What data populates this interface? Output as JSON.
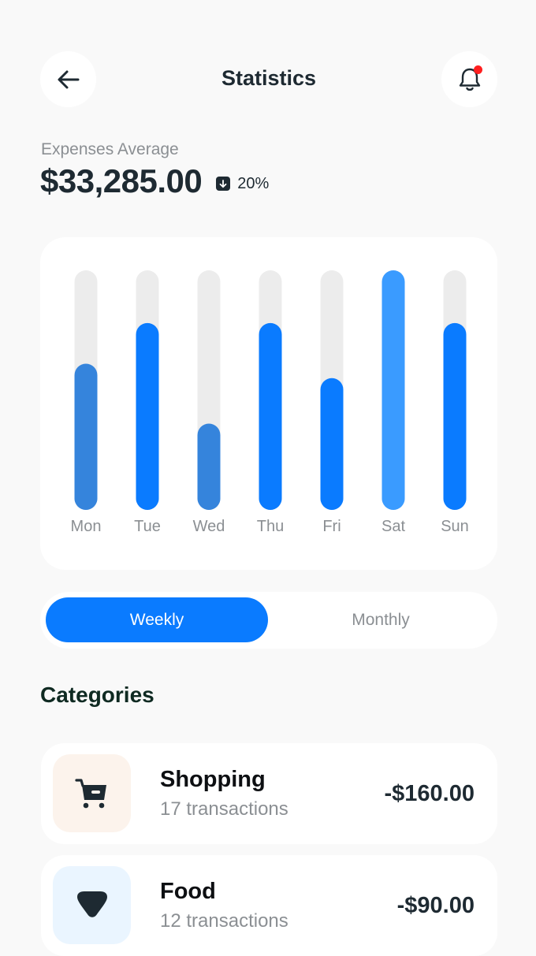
{
  "header": {
    "title": "Statistics",
    "back_icon": "arrow-left-icon",
    "notification_icon": "bell-icon",
    "notification_dot_color": "#ff1f1f"
  },
  "summary": {
    "label": "Expenses Average",
    "amount": "$33,285.00",
    "trend_icon": "arrow-down-square-icon",
    "trend_percent": "20%"
  },
  "chart_data": {
    "type": "bar",
    "categories": [
      "Mon",
      "Tue",
      "Wed",
      "Thu",
      "Fri",
      "Sat",
      "Sun"
    ],
    "values": [
      0.61,
      0.78,
      0.36,
      0.78,
      0.55,
      1.0,
      0.78
    ],
    "ylim": [
      0,
      1
    ],
    "colors": [
      "#3584dc",
      "#0a7bff",
      "#3584dc",
      "#0a7bff",
      "#0a7bff",
      "#3a9bff",
      "#0a7bff"
    ],
    "track_color": "#ececec",
    "grid": false
  },
  "tabs": {
    "weekly": "Weekly",
    "monthly": "Monthly",
    "active": "weekly",
    "active_color": "#0a7bff"
  },
  "categories_section": {
    "title": "Categories",
    "items": [
      {
        "name": "Shopping",
        "transactions": "17 transactions",
        "amount": "-$160.00",
        "icon": "shopping-cart-icon",
        "icon_bg": "#fcf3ec"
      },
      {
        "name": "Food",
        "transactions": "12 transactions",
        "amount": "-$90.00",
        "icon": "food-icon",
        "icon_bg": "#eaf5ff"
      }
    ]
  }
}
